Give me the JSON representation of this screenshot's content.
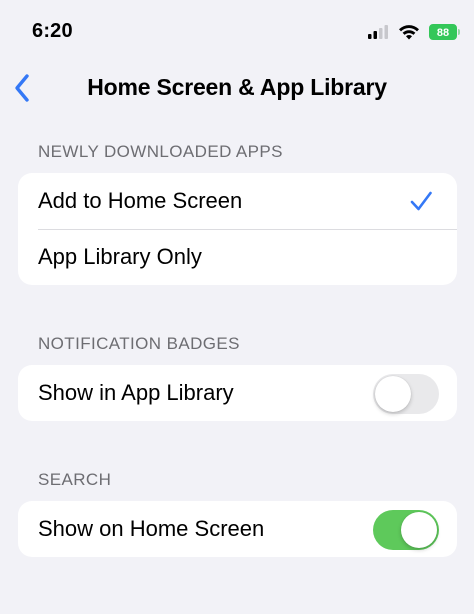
{
  "status_bar": {
    "time": "6:20",
    "battery_level": "88",
    "icons": [
      "signal-icon",
      "wifi-icon",
      "battery-icon"
    ]
  },
  "nav": {
    "title": "Home Screen & App Library",
    "back_icon": "chevron-left-icon"
  },
  "sections": {
    "newly_downloaded": {
      "header": "NEWLY DOWNLOADED APPS",
      "options": [
        {
          "label": "Add to Home Screen",
          "selected": true
        },
        {
          "label": "App Library Only",
          "selected": false
        }
      ]
    },
    "notification_badges": {
      "header": "NOTIFICATION BADGES",
      "rows": [
        {
          "label": "Show in App Library",
          "enabled": false
        }
      ]
    },
    "search": {
      "header": "SEARCH",
      "rows": [
        {
          "label": "Show on Home Screen",
          "enabled": true
        }
      ]
    }
  },
  "colors": {
    "accent": "#3478f6",
    "toggle_on": "#5ec95b",
    "toggle_off": "#e9e9eb",
    "background": "#f2f2f7",
    "battery": "#34c759"
  }
}
